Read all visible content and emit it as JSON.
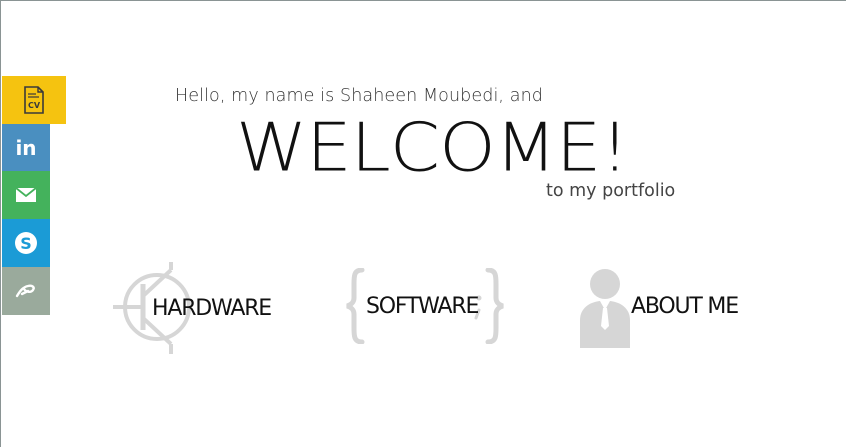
{
  "social": {
    "items": [
      {
        "name": "cv-icon",
        "color": "#f5c310"
      },
      {
        "name": "linkedin-icon",
        "color": "#4a8fc0"
      },
      {
        "name": "email-icon",
        "color": "#44b25c"
      },
      {
        "name": "skype-icon",
        "color": "#1b9bd6"
      },
      {
        "name": "deviantart-icon",
        "color": "#9aaa9c"
      }
    ],
    "cv_text": "CV",
    "linkedin_text": "in"
  },
  "hero": {
    "greeting": "Hello, my name is Shaheen Moubedi, and",
    "title": "WELCOME!",
    "subtitle": "to my portfolio"
  },
  "sections": {
    "hardware": {
      "label": "HARDWARE",
      "icon": "transistor-icon"
    },
    "software": {
      "label": "SOFTWARE",
      "icon": "curly-braces-icon"
    },
    "about": {
      "label": "ABOUT ME",
      "icon": "person-icon"
    }
  },
  "colors": {
    "icon_gray": "#d6d6d6",
    "text_dark": "#111111"
  }
}
